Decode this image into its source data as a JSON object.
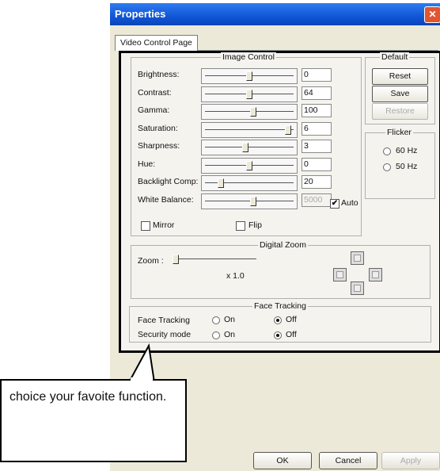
{
  "window": {
    "title": "Properties",
    "close_glyph": "✕"
  },
  "tabs": [
    {
      "label": "Video Control Page"
    }
  ],
  "image_control": {
    "title": "Image Control",
    "rows": [
      {
        "label": "Brightness:",
        "value": "0",
        "level": 0.5
      },
      {
        "label": "Contrast:",
        "value": "64",
        "level": 0.5
      },
      {
        "label": "Gamma:",
        "value": "100",
        "level": 0.55
      },
      {
        "label": "Saturation:",
        "value": "6",
        "level": 0.97
      },
      {
        "label": "Sharpness:",
        "value": "3",
        "level": 0.45
      },
      {
        "label": "Hue:",
        "value": "0",
        "level": 0.5
      },
      {
        "label": "Backlight Comp:",
        "value": "20",
        "level": 0.15
      },
      {
        "label": "White Balance:",
        "value": "5000",
        "level": 0.55,
        "disabled": true
      }
    ],
    "auto_label": "Auto",
    "auto_checked": true,
    "mirror_label": "Mirror",
    "flip_label": "Flip"
  },
  "default": {
    "title": "Default",
    "reset": "Reset",
    "save": "Save",
    "restore": "Restore"
  },
  "flicker": {
    "title": "Flicker",
    "opt_60": "60 Hz",
    "opt_50": "50 Hz"
  },
  "digital_zoom": {
    "title": "Digital Zoom",
    "zoom_label": "Zoom :",
    "zoom_value": "x 1.0",
    "level": 0.0
  },
  "face_tracking": {
    "title": "Face Tracking",
    "rows": [
      {
        "label": "Face Tracking",
        "on": "On",
        "off": "Off",
        "selected": "off"
      },
      {
        "label": "Security mode",
        "on": "On",
        "off": "Off",
        "selected": "off"
      }
    ]
  },
  "footer": {
    "ok": "OK",
    "cancel": "Cancel",
    "apply": "Apply"
  },
  "callout": {
    "text": "choice your favoite function."
  }
}
